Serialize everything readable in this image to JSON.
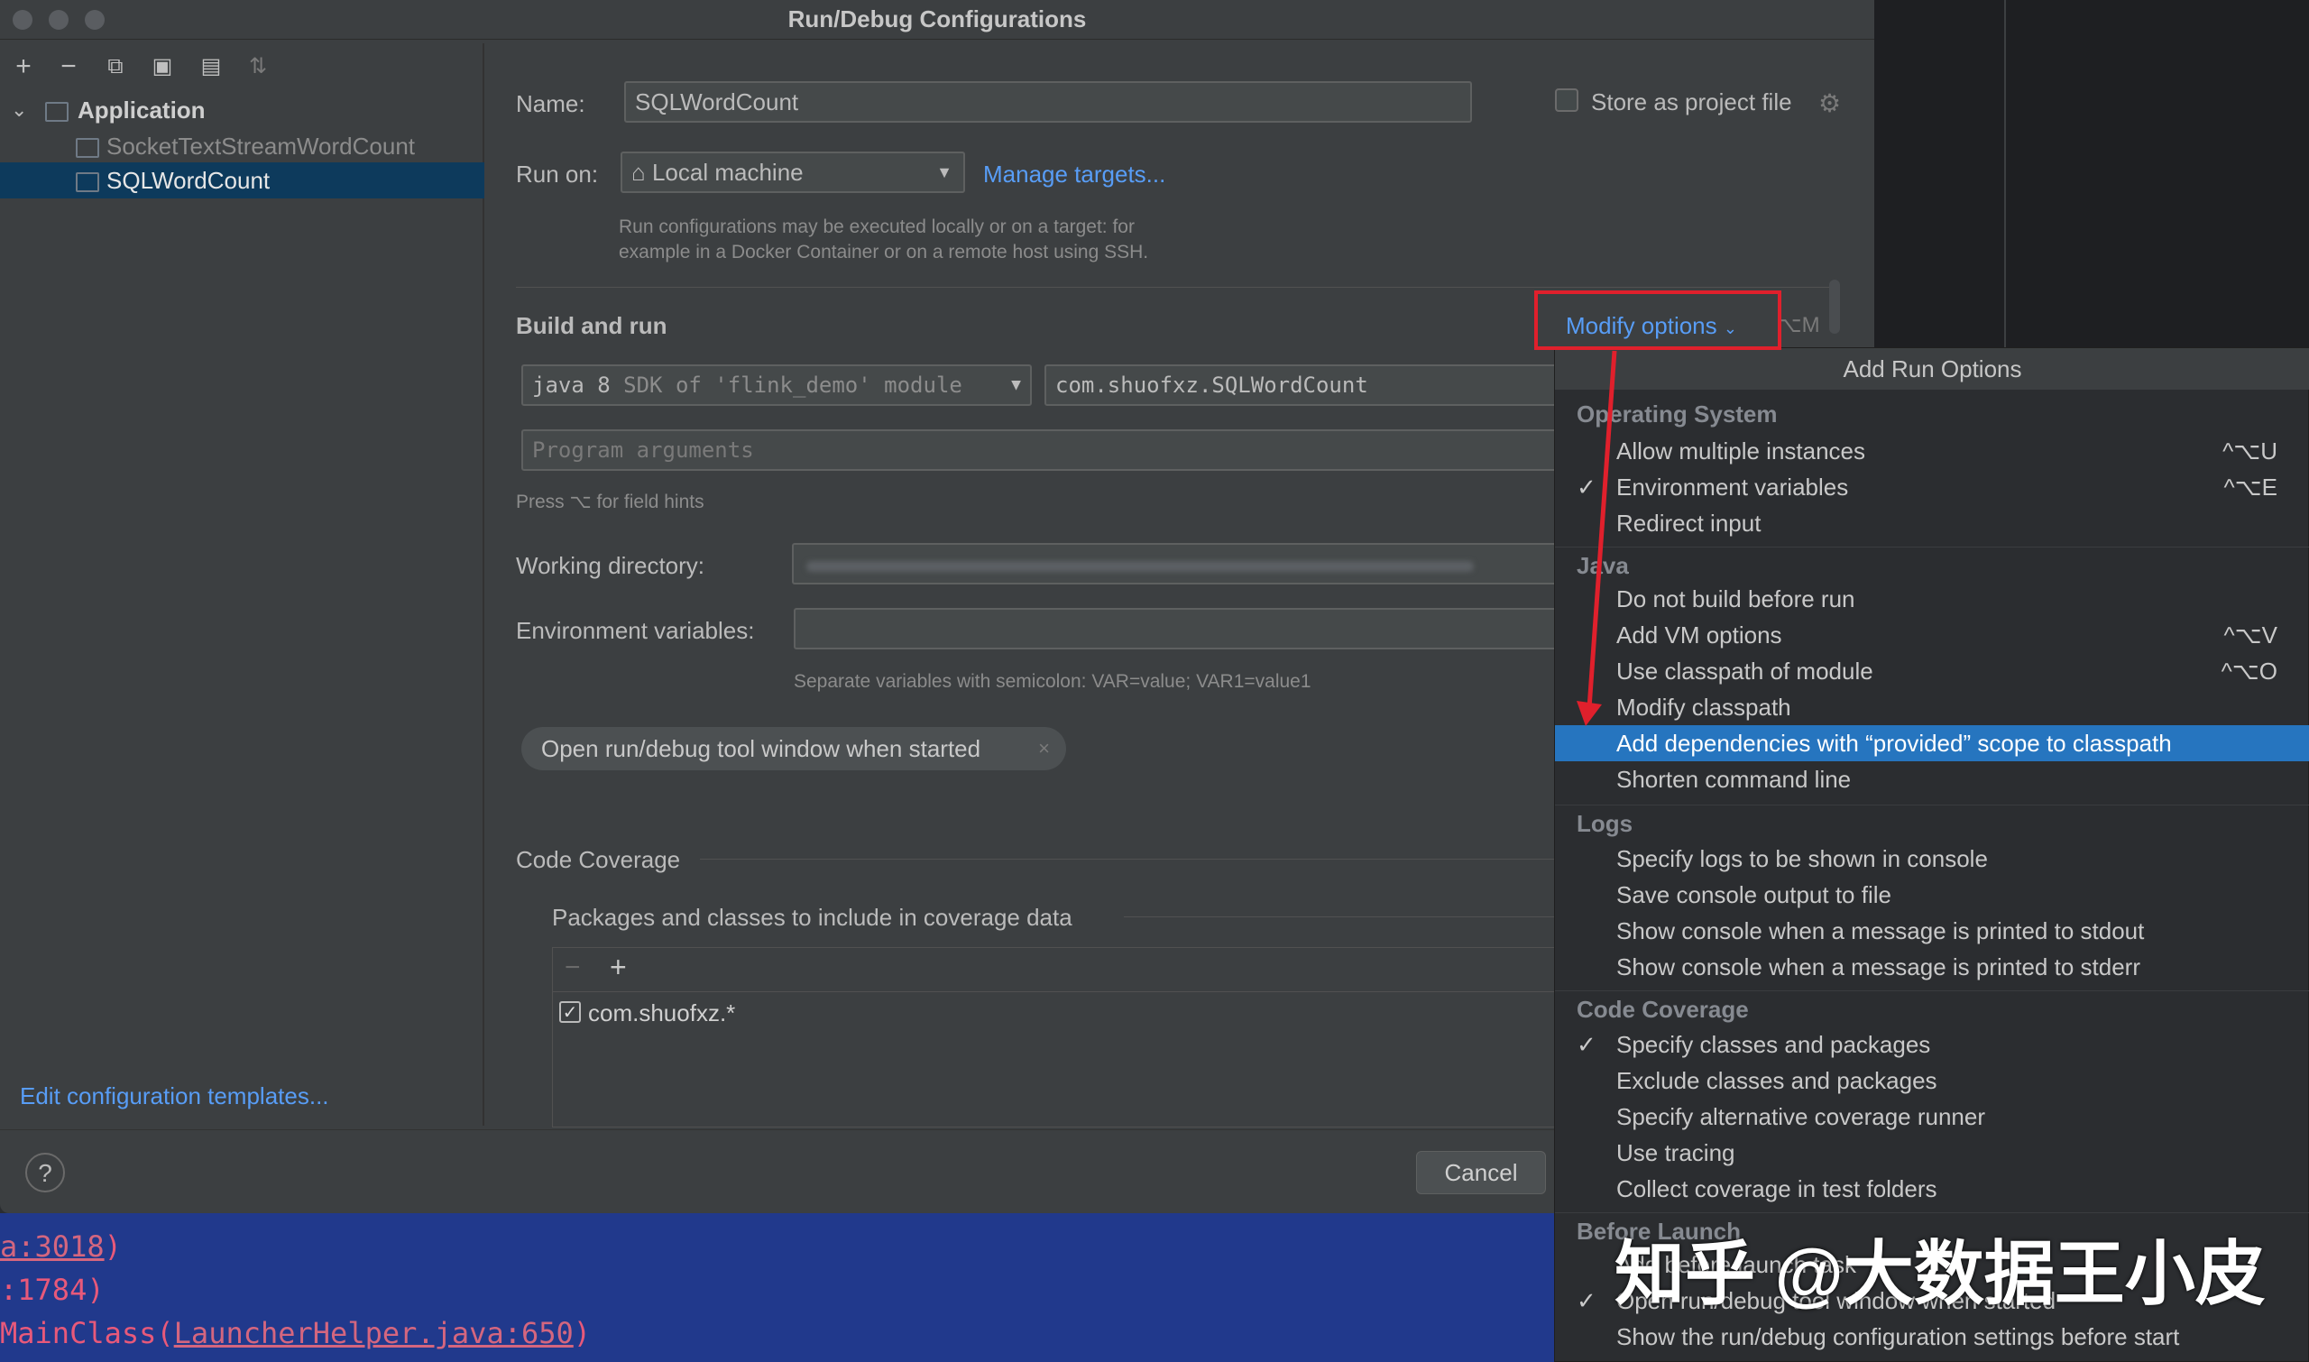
{
  "window": {
    "title": "Run/Debug Configurations"
  },
  "toolbar_icons": [
    "plus-icon",
    "minus-icon",
    "copy-icon",
    "save-icon",
    "folder-add-icon",
    "sort-icon"
  ],
  "tree": {
    "root": "Application",
    "items": [
      "SocketTextStreamWordCount",
      "SQLWordCount"
    ],
    "selected": "SQLWordCount"
  },
  "edit_templates_link": "Edit configuration templates...",
  "help_label": "?",
  "form": {
    "name_label": "Name:",
    "name_value": "SQLWordCount",
    "store_label": "Store as project file",
    "run_on_label": "Run on:",
    "run_on_value": "Local machine",
    "manage_targets": "Manage targets...",
    "run_on_hint_1": "Run configurations may be executed locally or on a target: for",
    "run_on_hint_2": "example in a Docker Container or on a remote host using SSH.",
    "build_and_run": "Build and run",
    "modify_options": "Modify options",
    "modify_shortcut": "⌥M",
    "sdk_java": "java 8",
    "sdk_rest": "SDK of 'flink_demo' module",
    "main_class": "com.shuofxz.SQLWordCount",
    "program_args_placeholder": "Program arguments",
    "field_hints": "Press ⌥ for field hints",
    "working_dir_label": "Working directory:",
    "env_vars_label": "Environment variables:",
    "env_hint": "Separate variables with semicolon: VAR=value; VAR1=value1",
    "open_tool_window_chip": "Open run/debug tool window when started",
    "code_coverage": "Code Coverage",
    "packages_label": "Packages and classes to include in coverage data",
    "coverage_item": "com.shuofxz.*",
    "cancel": "Cancel"
  },
  "popup": {
    "title": "Add Run Options",
    "groups": [
      {
        "name": "Operating System",
        "items": [
          {
            "label": "Allow multiple instances",
            "checked": false,
            "shortcut": "^⌥U"
          },
          {
            "label": "Environment variables",
            "checked": true,
            "shortcut": "^⌥E"
          },
          {
            "label": "Redirect input",
            "checked": false,
            "shortcut": ""
          }
        ]
      },
      {
        "name": "Java",
        "items": [
          {
            "label": "Do not build before run",
            "checked": false,
            "shortcut": ""
          },
          {
            "label": "Add VM options",
            "checked": false,
            "shortcut": "^⌥V"
          },
          {
            "label": "Use classpath of module",
            "checked": false,
            "shortcut": "^⌥O"
          },
          {
            "label": "Modify classpath",
            "checked": false,
            "shortcut": ""
          },
          {
            "label": "Add dependencies with “provided” scope to classpath",
            "checked": false,
            "shortcut": "",
            "selected": true
          },
          {
            "label": "Shorten command line",
            "checked": false,
            "shortcut": ""
          }
        ]
      },
      {
        "name": "Logs",
        "items": [
          {
            "label": "Specify logs to be shown in console",
            "checked": false,
            "shortcut": ""
          },
          {
            "label": "Save console output to file",
            "checked": false,
            "shortcut": ""
          },
          {
            "label": "Show console when a message is printed to stdout",
            "checked": false,
            "shortcut": ""
          },
          {
            "label": "Show console when a message is printed to stderr",
            "checked": false,
            "shortcut": ""
          }
        ]
      },
      {
        "name": "Code Coverage",
        "items": [
          {
            "label": "Specify classes and packages",
            "checked": true,
            "shortcut": ""
          },
          {
            "label": "Exclude classes and packages",
            "checked": false,
            "shortcut": ""
          },
          {
            "label": "Specify alternative coverage runner",
            "checked": false,
            "shortcut": ""
          },
          {
            "label": "Use tracing",
            "checked": false,
            "shortcut": ""
          },
          {
            "label": "Collect coverage in test folders",
            "checked": false,
            "shortcut": ""
          }
        ]
      },
      {
        "name": "Before Launch",
        "items": [
          {
            "label": "Add before launch task",
            "checked": false,
            "shortcut": ""
          },
          {
            "label": "Open run/debug tool window when started",
            "checked": true,
            "shortcut": ""
          },
          {
            "label": "Show the run/debug configuration settings before start",
            "checked": false,
            "shortcut": ""
          }
        ]
      }
    ]
  },
  "console": {
    "line1_link": "a:3018",
    "line1_tail": ")",
    "line2": ":1784)",
    "line3_prefix": "MainClass(",
    "line3_link": "LauncherHelper.java:650",
    "line3_tail": ")"
  },
  "watermark": "知乎 @大数据王小皮",
  "colors": {
    "accent": "#589df6",
    "selection": "#2675bf",
    "annotation_red": "#e0202c"
  }
}
